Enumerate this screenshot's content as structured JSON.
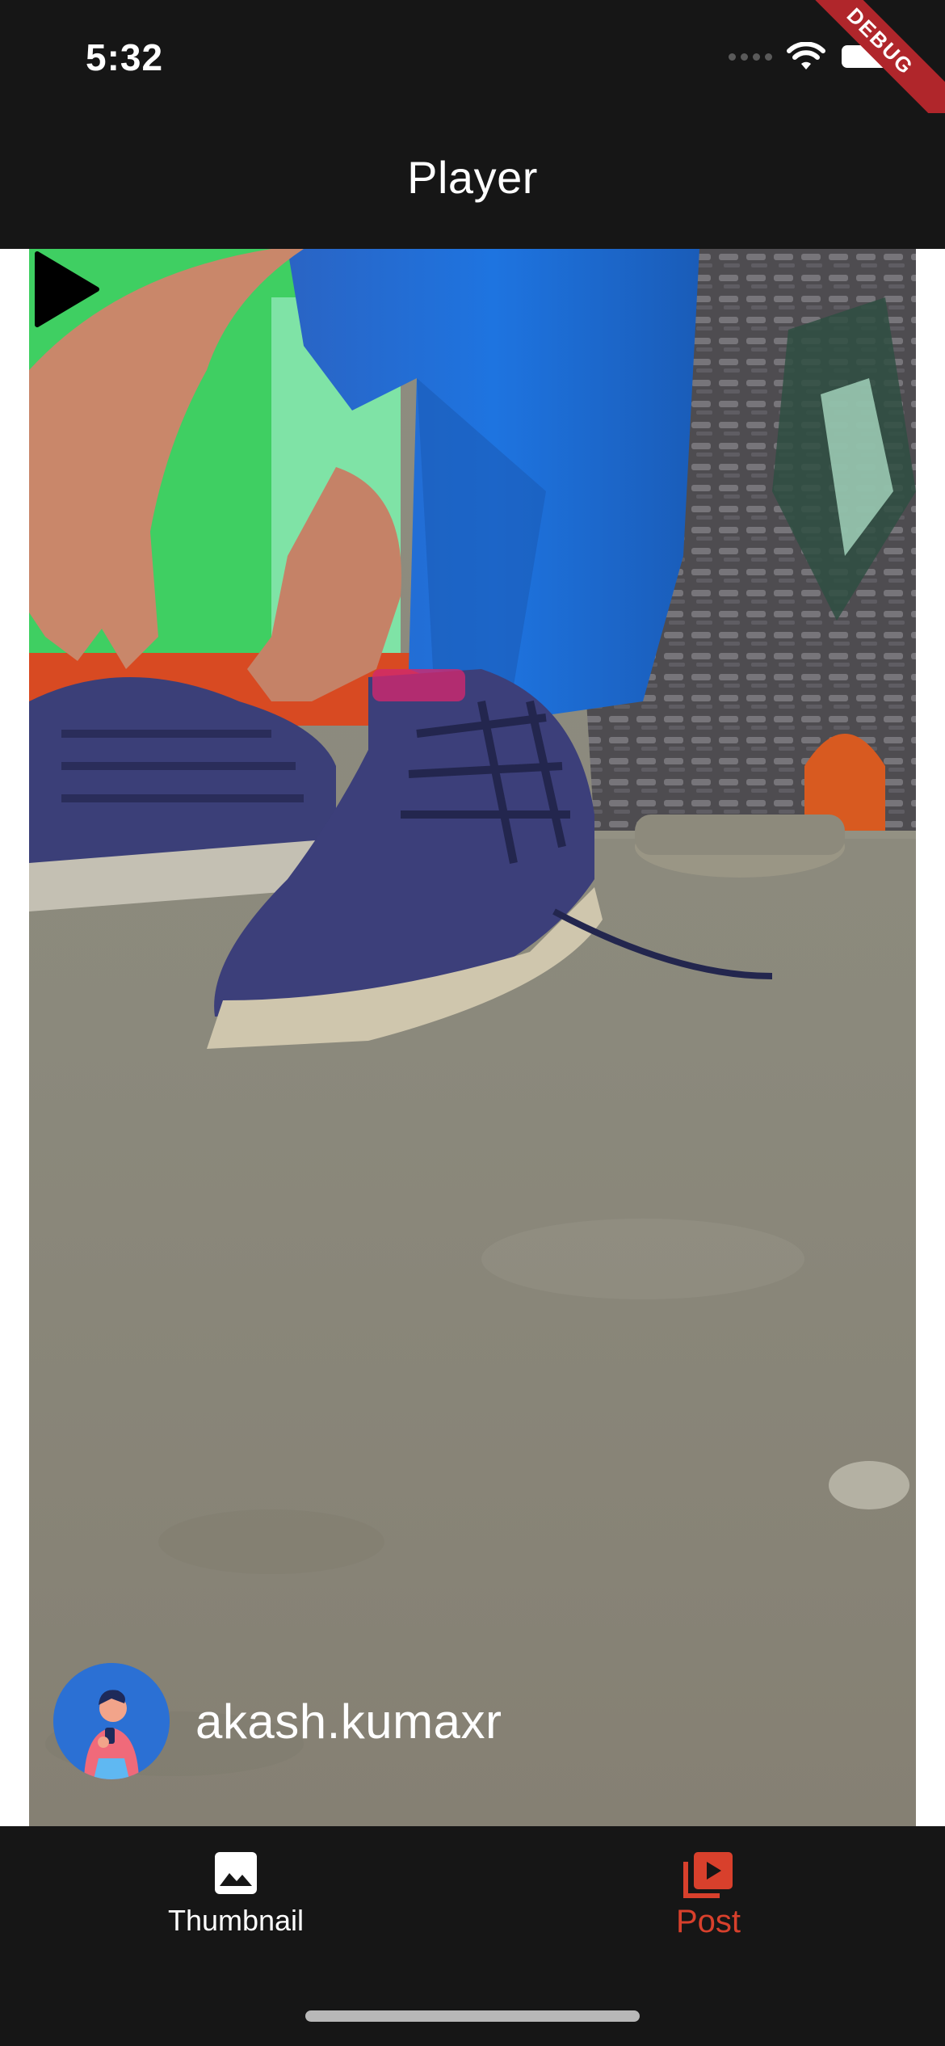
{
  "status_bar": {
    "time": "5:32",
    "debug_label": "DEBUG",
    "icons": [
      "cellular-signal-icon",
      "wifi-icon",
      "battery-icon"
    ]
  },
  "app_bar": {
    "title": "Player"
  },
  "video": {
    "play_icon": "play-icon",
    "uploader": {
      "username": "akash.kumaxr",
      "avatar_icon": "avatar-illustration-icon"
    }
  },
  "bottom_nav": {
    "items": [
      {
        "label": "Thumbnail",
        "icon": "image-icon",
        "selected": false
      },
      {
        "label": "Post",
        "icon": "video-library-icon",
        "selected": true
      }
    ],
    "active_color": "#d8402c",
    "inactive_color": "#ffffff"
  },
  "colors": {
    "background": "#161616",
    "accent": "#d8402c"
  }
}
